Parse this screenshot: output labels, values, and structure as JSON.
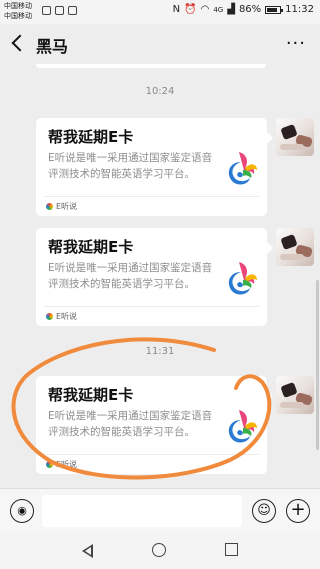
{
  "status_bar": {
    "carrier_1": "中国移动",
    "carrier_2": "中国移动",
    "signal": "4G",
    "battery": "86%",
    "time": "11:32"
  },
  "header": {
    "title": "黑马",
    "more_label": "···"
  },
  "chat": {
    "timestamps": [
      "10:24",
      "11:31"
    ],
    "messages": [
      {
        "title": "帮我延期E卡",
        "description": "E听说是唯一采用通过国家鉴定语音评测技术的智能英语学习平台。",
        "source": "E听说"
      },
      {
        "title": "帮我延期E卡",
        "description": "E听说是唯一采用通过国家鉴定语音评测技术的智能英语学习平台。",
        "source": "E听说"
      },
      {
        "title": "帮我延期E卡",
        "description": "E听说是唯一采用通过国家鉴定语音评测技术的智能英语学习平台。",
        "source": "E听说"
      }
    ]
  },
  "input_bar": {
    "voice_icon": "voice-icon",
    "emoji_icon": "emoji-icon",
    "plus_icon": "plus-icon"
  },
  "colors": {
    "annotation": "#f08a3c",
    "background": "#ededed",
    "card": "#ffffff"
  }
}
